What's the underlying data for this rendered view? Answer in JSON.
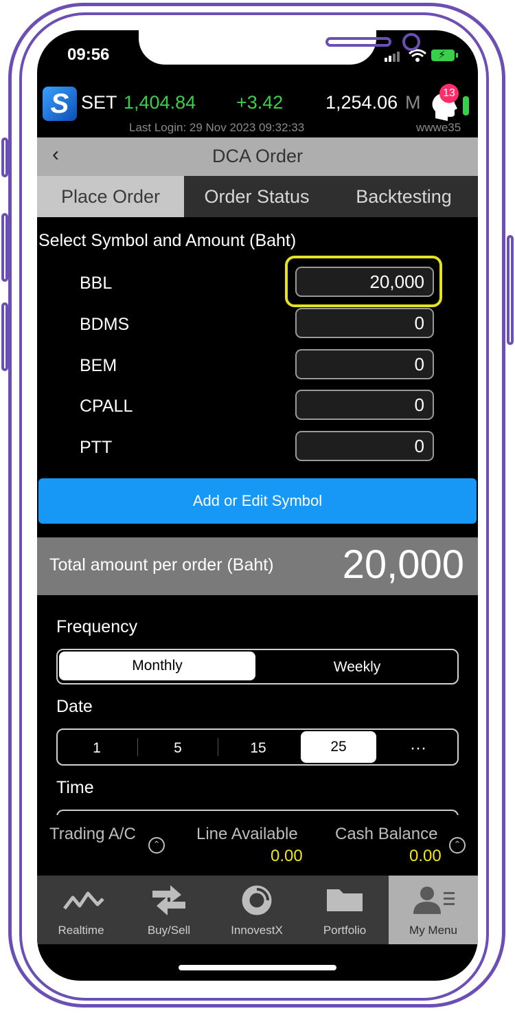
{
  "status_bar": {
    "time": "09:56"
  },
  "ticker": {
    "index_name": "SET",
    "index_value": "1,404.84",
    "change": "+3.42",
    "volume": "1,254.06",
    "volume_unit": "M",
    "notifications": "13",
    "last_login": "Last Login: 29 Nov 2023 09:32:33",
    "user": "wwwe35"
  },
  "header": {
    "title": "DCA Order",
    "back_icon": "chevron-left-icon"
  },
  "tabs": [
    {
      "label": "Place Order",
      "active": true
    },
    {
      "label": "Order Status",
      "active": false
    },
    {
      "label": "Backtesting",
      "active": false
    }
  ],
  "symbols_section": {
    "label": "Select Symbol and Amount (Baht)",
    "rows": [
      {
        "symbol": "BBL",
        "amount": "20,000"
      },
      {
        "symbol": "BDMS",
        "amount": "0"
      },
      {
        "symbol": "BEM",
        "amount": "0"
      },
      {
        "symbol": "CPALL",
        "amount": "0"
      },
      {
        "symbol": "PTT",
        "amount": "0"
      }
    ],
    "add_button": "Add or Edit Symbol"
  },
  "total": {
    "label": "Total amount per order (Baht)",
    "value": "20,000"
  },
  "frequency": {
    "label": "Frequency",
    "options": [
      "Monthly",
      "Weekly"
    ],
    "selected": "Monthly"
  },
  "date": {
    "label": "Date",
    "options": [
      "1",
      "5",
      "15",
      "25",
      "···"
    ],
    "selected": "25"
  },
  "time": {
    "label": "Time"
  },
  "account": {
    "trading_label": "Trading A/C",
    "line_label": "Line Available",
    "line_value": "0.00",
    "cash_label": "Cash Balance",
    "cash_value": "0.00"
  },
  "bottom_nav": [
    {
      "label": "Realtime",
      "icon": "chart-line-icon"
    },
    {
      "label": "Buy/Sell",
      "icon": "arrows-swap-icon"
    },
    {
      "label": "InnovestX",
      "icon": "donut-icon"
    },
    {
      "label": "Portfolio",
      "icon": "folder-icon"
    },
    {
      "label": "My Menu",
      "icon": "user-menu-icon",
      "active": true
    }
  ],
  "colors": {
    "accent_blue": "#1797f6",
    "up_green": "#38d04a",
    "highlight_yellow": "#e5e320",
    "value_yellow": "#f2e51c",
    "frame_purple": "#6b4fb5"
  }
}
